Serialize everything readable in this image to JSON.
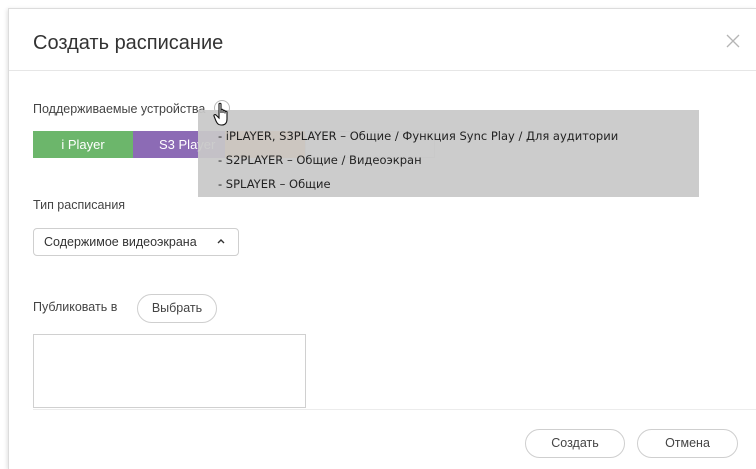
{
  "dialog": {
    "title": "Создать расписание",
    "close_icon": "close-icon"
  },
  "devices": {
    "label": "Поддерживаемые устройства",
    "help_icon": "help-icon",
    "chips": [
      {
        "label": "i Player",
        "color": "#6cb66b"
      },
      {
        "label": "S3 Player",
        "color": "#8c6bb5"
      },
      {
        "label": "",
        "color": "#f3a65c"
      },
      {
        "label": "",
        "color": "#ffffff"
      }
    ],
    "tooltip": [
      "- iPLAYER, S3PLAYER – Общие / Функция Sync Play / Для аудитории",
      "- S2PLAYER – Общие / Видеоэкран",
      "- SPLAYER – Общие"
    ]
  },
  "schedule_type": {
    "label": "Тип расписания",
    "selected": "Содержимое видеоэкрана",
    "chevron_icon": "chevron-up-icon"
  },
  "publish": {
    "label": "Публиковать в",
    "select_button": "Выбрать"
  },
  "footer": {
    "create_button": "Создать",
    "cancel_button": "Отмена"
  }
}
